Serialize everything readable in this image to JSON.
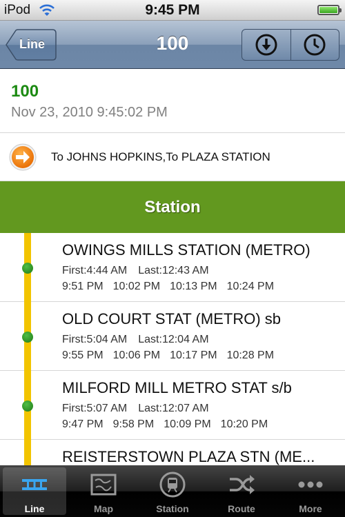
{
  "status_bar": {
    "carrier": "iPod",
    "time": "9:45 PM"
  },
  "nav": {
    "back_label": "Line",
    "title": "100"
  },
  "route": {
    "number": "100",
    "timestamp": "Nov 23, 2010 9:45:02 PM"
  },
  "destination": "To JOHNS HOPKINS,To PLAZA STATION",
  "section_title": "Station",
  "stations": [
    {
      "name": "OWINGS MILLS STATION (METRO)",
      "first": "First:4:44 AM",
      "last": "Last:12:43 AM",
      "times": [
        "9:51 PM",
        "10:02 PM",
        "10:13 PM",
        "10:24 PM"
      ]
    },
    {
      "name": "OLD COURT STAT (METRO) sb",
      "first": "First:5:04 AM",
      "last": "Last:12:04 AM",
      "times": [
        "9:55 PM",
        "10:06 PM",
        "10:17 PM",
        "10:28 PM"
      ]
    },
    {
      "name": "MILFORD MILL METRO STAT s/b",
      "first": "First:5:07 AM",
      "last": "Last:12:07 AM",
      "times": [
        "9:47 PM",
        "9:58 PM",
        "10:09 PM",
        "10:20 PM"
      ]
    },
    {
      "name": "REISTERSTOWN PLAZA STN (ME...",
      "first": "",
      "last": "",
      "times": []
    }
  ],
  "tabs": [
    {
      "label": "Line",
      "icon": "line-icon",
      "active": true
    },
    {
      "label": "Map",
      "icon": "map-icon",
      "active": false
    },
    {
      "label": "Station",
      "icon": "station-icon",
      "active": false
    },
    {
      "label": "Route",
      "icon": "route-icon",
      "active": false
    },
    {
      "label": "More",
      "icon": "more-icon",
      "active": false
    }
  ],
  "colors": {
    "route_green": "#1c8a12",
    "section_green": "#62981f",
    "track_yellow": "#f2c400",
    "stop_green": "#2a9a20"
  }
}
